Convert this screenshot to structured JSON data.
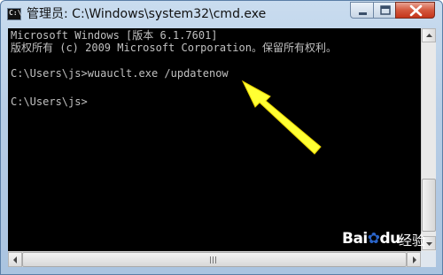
{
  "window": {
    "title": "管理员: C:\\Windows\\system32\\cmd.exe",
    "icon_label": "C:\\",
    "colors": {
      "console_bg": "#000000",
      "console_text": "#c0c0c0",
      "arrow": "#ffff33",
      "close_button": "#c4351b"
    }
  },
  "controls": {
    "minimize_icon": "minimize-icon",
    "maximize_icon": "maximize-icon",
    "close_icon": "close-icon"
  },
  "console": {
    "lines": [
      "Microsoft Windows [版本 6.1.7601]",
      "版权所有 (c) 2009 Microsoft Corporation。保留所有权利。",
      "",
      "C:\\Users\\js>wuauclt.exe /updatenow",
      "",
      "C:\\Users\\js>"
    ]
  },
  "watermark": {
    "brand_a": "Bai",
    "brand_b": "du",
    "suffix": "经验"
  }
}
